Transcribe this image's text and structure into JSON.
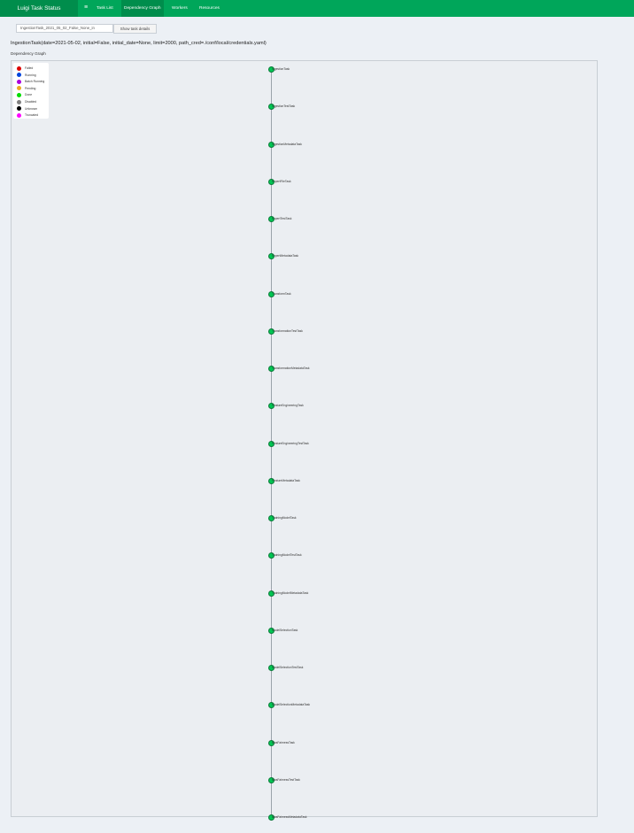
{
  "header": {
    "brand": "Luigi Task Status",
    "menu_icon": "hamburger-icon",
    "nav": [
      {
        "label": "Task List"
      },
      {
        "label": "Dependency Graph"
      },
      {
        "label": "Workers"
      },
      {
        "label": "Resources"
      }
    ],
    "active_nav": "Dependency Graph"
  },
  "controls": {
    "task_id_value": "IngestionTask_2021_05_02_False_None_in",
    "show_details_label": "Show task details"
  },
  "main": {
    "task_title": "IngestionTask(date=2021-05-02, initial=False, initial_date=None, limit=2000, path_cred=./conf/local/credentials.yaml)",
    "section_label": "Dependency Graph"
  },
  "legend": [
    {
      "label": "Failed",
      "color": "#dd0000"
    },
    {
      "label": "Running",
      "color": "#0044dd"
    },
    {
      "label": "Batch Running",
      "color": "#aa00dd"
    },
    {
      "label": "Pending",
      "color": "#eeaa22"
    },
    {
      "label": "Done",
      "color": "#00dd00"
    },
    {
      "label": "Disabled",
      "color": "#808080"
    },
    {
      "label": "Unknown",
      "color": "#000000"
    },
    {
      "label": "Truncated",
      "color": "#ff00ff"
    }
  ],
  "graph": {
    "node_color": "#00c853",
    "nodes": [
      {
        "label": "IngestionTask"
      },
      {
        "label": "IngestionTestTask"
      },
      {
        "label": "IngestionMetadataTask"
      },
      {
        "label": "ExpertFileTask"
      },
      {
        "label": "ExpertTestTask"
      },
      {
        "label": "ExpertMetadataTask"
      },
      {
        "label": "TransformTask"
      },
      {
        "label": "TransformationTestTask"
      },
      {
        "label": "TransformationMetadataTask"
      },
      {
        "label": "FeatureEngineeringTask"
      },
      {
        "label": "FeatureEngineeringTestTask"
      },
      {
        "label": "FeatureMetadataTask"
      },
      {
        "label": "TrainingModelTask"
      },
      {
        "label": "TrainingModelTestTask"
      },
      {
        "label": "TrainingModelMetadataTask"
      },
      {
        "label": "ModelSelectionTask"
      },
      {
        "label": "ModelSelectionTestTask"
      },
      {
        "label": "ModelSelectionMetadataTask"
      },
      {
        "label": "BiasFairnessTask"
      },
      {
        "label": "BiasFairnessTestTask"
      },
      {
        "label": "BiasFairnessMetadataTask"
      }
    ]
  }
}
